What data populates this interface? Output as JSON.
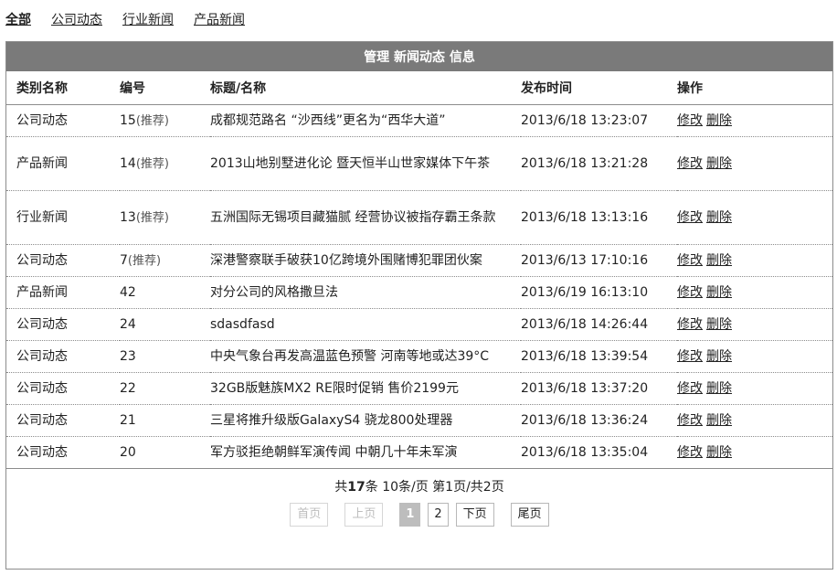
{
  "filter_tabs": [
    {
      "label": "全部",
      "active": true
    },
    {
      "label": "公司动态",
      "active": false
    },
    {
      "label": "行业新闻",
      "active": false
    },
    {
      "label": "产品新闻",
      "active": false
    }
  ],
  "panel": {
    "title": "管理 新闻动态 信息"
  },
  "table": {
    "headers": {
      "category": "类别名称",
      "id": "编号",
      "title": "标题/名称",
      "time": "发布时间",
      "ops": "操作"
    },
    "rows": [
      {
        "category": "公司动态",
        "id": "15",
        "rec": "(推荐)",
        "title": "成都规范路名 “沙西线”更名为“西华大道”",
        "time": "2013/6/18 13:23:07"
      },
      {
        "category": "产品新闻",
        "id": "14",
        "rec": "(推荐)",
        "title": "2013山地别墅进化论 暨天恒半山世家媒体下午茶",
        "time": "2013/6/18 13:21:28"
      },
      {
        "category": "行业新闻",
        "id": "13",
        "rec": "(推荐)",
        "title": "五洲国际无锡项目藏猫腻 经营协议被指存霸王条款",
        "time": "2013/6/18 13:13:16"
      },
      {
        "category": "公司动态",
        "id": "7",
        "rec": "(推荐)",
        "title": "深港警察联手破获10亿跨境外围赌博犯罪团伙案",
        "time": "2013/6/13 17:10:16"
      },
      {
        "category": "产品新闻",
        "id": "42",
        "rec": "",
        "title": "对分公司的风格撒旦法",
        "time": "2013/6/19 16:13:10"
      },
      {
        "category": "公司动态",
        "id": "24",
        "rec": "",
        "title": "sdasdfasd",
        "time": "2013/6/18 14:26:44"
      },
      {
        "category": "公司动态",
        "id": "23",
        "rec": "",
        "title": "中央气象台再发高温蓝色预警 河南等地或达39°C",
        "time": "2013/6/18 13:39:54"
      },
      {
        "category": "公司动态",
        "id": "22",
        "rec": "",
        "title": "32GB版魅族MX2 RE限时促销 售价2199元",
        "time": "2013/6/18 13:37:20"
      },
      {
        "category": "公司动态",
        "id": "21",
        "rec": "",
        "title": "三星将推升级版GalaxyS4 骁龙800处理器",
        "time": "2013/6/18 13:36:24"
      },
      {
        "category": "公司动态",
        "id": "20",
        "rec": "",
        "title": "军方驳拒绝朝鲜军演传闻 中朝几十年未军演",
        "time": "2013/6/18 13:35:04"
      }
    ],
    "edit_label": "修改",
    "delete_label": "删除"
  },
  "pager": {
    "summary_prefix": "共",
    "total": "17",
    "summary_suffix": "条 10条/页 第1页/共2页",
    "first": "首页",
    "prev": "上页",
    "pages": [
      "1",
      "2"
    ],
    "current": "1",
    "next": "下页",
    "last": "尾页"
  }
}
